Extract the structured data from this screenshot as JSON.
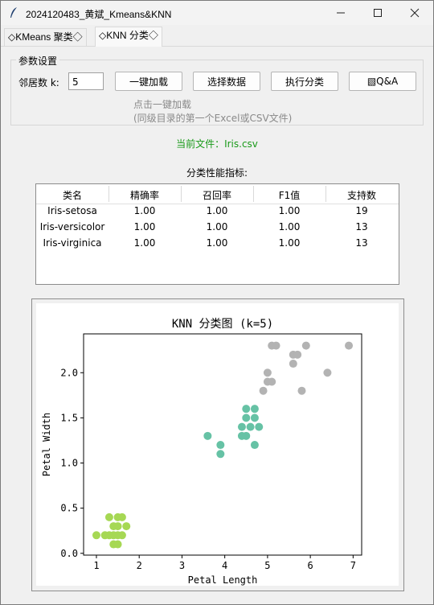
{
  "window": {
    "title": "2024120483_黄斌_Kmeans&KNN"
  },
  "tabs": [
    {
      "label": "◇KMeans 聚类◇"
    },
    {
      "label": "◇KNN 分类◇"
    }
  ],
  "params": {
    "group_title": "参数设置",
    "k_label": "邻居数 k:",
    "k_value": "5",
    "buttons": {
      "load": "一键加载",
      "select": "选择数据",
      "classify": "执行分类",
      "qa": "▧Q&A"
    },
    "hint_line1": "点击一键加载",
    "hint_line2": "(同级目录的第一个Excel或CSV文件)"
  },
  "current_file": "当前文件：Iris.csv",
  "metrics": {
    "title": "分类性能指标:",
    "headers": [
      "类名",
      "精确率",
      "召回率",
      "F1值",
      "支持数"
    ],
    "rows": [
      [
        "Iris-setosa",
        "1.00",
        "1.00",
        "1.00",
        "19"
      ],
      [
        "Iris-versicolor",
        "1.00",
        "1.00",
        "1.00",
        "13"
      ],
      [
        "Iris-virginica",
        "1.00",
        "1.00",
        "1.00",
        "13"
      ]
    ]
  },
  "chart_data": {
    "type": "scatter",
    "title": "KNN 分类图 (k=5)",
    "xlabel": "Petal Length",
    "ylabel": "Petal Width",
    "xlim": [
      0.7,
      7.2
    ],
    "ylim": [
      -0.02,
      2.43
    ],
    "xticks": [
      1,
      2,
      3,
      4,
      5,
      6,
      7
    ],
    "yticks": [
      0.0,
      0.5,
      1.0,
      1.5,
      2.0
    ],
    "grid": false,
    "colors": {
      "setosa": "#a6d854",
      "versicolor": "#66c2a5",
      "virginica": "#b3b3b3"
    },
    "series": [
      {
        "class": "setosa",
        "points": [
          [
            1.0,
            0.2
          ],
          [
            1.3,
            0.4
          ],
          [
            1.4,
            0.3
          ],
          [
            1.5,
            0.4
          ],
          [
            1.6,
            0.4
          ],
          [
            1.3,
            0.2
          ],
          [
            1.4,
            0.2
          ],
          [
            1.5,
            0.2
          ],
          [
            1.6,
            0.2
          ],
          [
            1.4,
            0.1
          ],
          [
            1.5,
            0.1
          ],
          [
            1.7,
            0.3
          ],
          [
            1.2,
            0.2
          ],
          [
            1.5,
            0.3
          ]
        ]
      },
      {
        "class": "versicolor",
        "points": [
          [
            3.6,
            1.3
          ],
          [
            3.9,
            1.2
          ],
          [
            3.9,
            1.1
          ],
          [
            4.4,
            1.4
          ],
          [
            4.5,
            1.5
          ],
          [
            4.5,
            1.3
          ],
          [
            4.5,
            1.6
          ],
          [
            4.6,
            1.4
          ],
          [
            4.7,
            1.2
          ],
          [
            4.7,
            1.5
          ],
          [
            4.7,
            1.6
          ],
          [
            4.8,
            1.4
          ],
          [
            4.4,
            1.3
          ]
        ]
      },
      {
        "class": "virginica",
        "points": [
          [
            4.9,
            1.8
          ],
          [
            5.0,
            1.9
          ],
          [
            5.0,
            2.0
          ],
          [
            5.1,
            1.9
          ],
          [
            5.1,
            2.3
          ],
          [
            5.2,
            2.3
          ],
          [
            5.6,
            2.1
          ],
          [
            5.6,
            2.2
          ],
          [
            5.7,
            2.2
          ],
          [
            5.8,
            1.8
          ],
          [
            5.9,
            2.3
          ],
          [
            6.4,
            2.0
          ],
          [
            6.9,
            2.3
          ]
        ]
      }
    ]
  }
}
